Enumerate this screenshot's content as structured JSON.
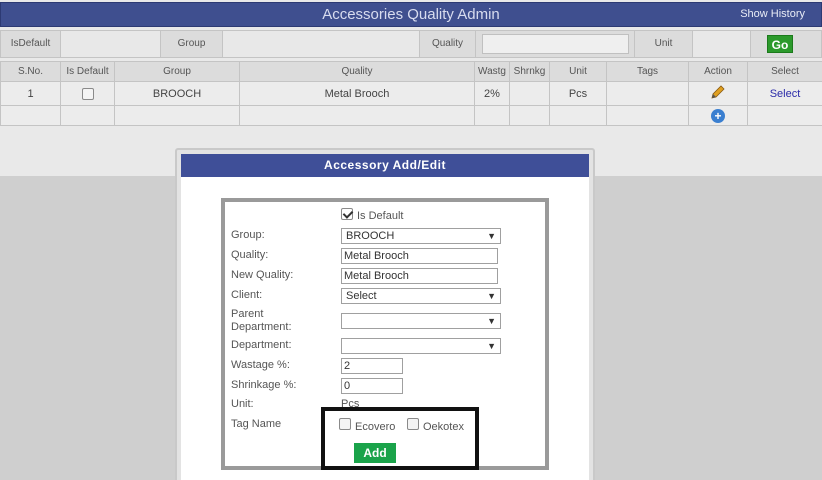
{
  "header": {
    "title": "Accessories Quality Admin",
    "show_history": "Show History"
  },
  "filter": {
    "isdefault_label": "IsDefault",
    "group_label": "Group",
    "quality_label": "Quality",
    "unit_label": "Unit",
    "go_label": "Go"
  },
  "table": {
    "columns": [
      "S.No.",
      "Is Default",
      "Group",
      "Quality",
      "Wastg",
      "Shrnkg",
      "Unit",
      "Tags",
      "Action",
      "Select"
    ],
    "rows": [
      {
        "sno": "1",
        "is_default": false,
        "group": "BROOCH",
        "quality": "Metal Brooch",
        "wastg": "2%",
        "shrnkg": "",
        "unit": "Pcs",
        "tags": "",
        "select": "Select"
      }
    ]
  },
  "modal": {
    "title": "Accessory Add/Edit",
    "is_default_label": "Is Default",
    "is_default_checked": true,
    "labels": {
      "group": "Group:",
      "quality": "Quality:",
      "new_quality": "New Quality:",
      "client": "Client:",
      "parent_department_1": "Parent",
      "parent_department_2": "Department:",
      "department": "Department:",
      "wastage": "Wastage %:",
      "shrinkage": "Shrinkage %:",
      "unit": "Unit:",
      "tag_name": "Tag Name"
    },
    "values": {
      "group": "BROOCH",
      "quality": "Metal Brooch",
      "new_quality": "Metal Brooch",
      "client": "Select",
      "parent_department": "",
      "department": "",
      "wastage": "2",
      "shrinkage": "0",
      "unit": "Pcs"
    },
    "tags": [
      {
        "label": "Ecovero",
        "checked": false
      },
      {
        "label": "Oekotex",
        "checked": false
      }
    ],
    "add_label": "Add"
  },
  "colors": {
    "header_bg": "#3f4f8f",
    "go_bg": "#2c9a2c",
    "add_bg": "#1aa34a",
    "link": "#2b2ba8"
  }
}
